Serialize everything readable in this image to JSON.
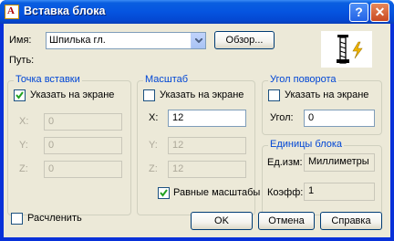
{
  "window": {
    "title": "Вставка блока"
  },
  "name_row": {
    "label": "Имя:",
    "value": "Шпилька гл.",
    "browse_label": "Обзор..."
  },
  "path_label": "Путь:",
  "insertion": {
    "title": "Точка вставки",
    "on_screen_label": "Указать на экране",
    "on_screen_checked": true,
    "x_label": "X:",
    "x_value": "0",
    "y_label": "Y:",
    "y_value": "0",
    "z_label": "Z:",
    "z_value": "0"
  },
  "scale": {
    "title": "Масштаб",
    "on_screen_label": "Указать на экране",
    "on_screen_checked": false,
    "x_label": "X:",
    "x_value": "12",
    "y_label": "Y:",
    "y_value": "12",
    "z_label": "Z:",
    "z_value": "12",
    "uniform_label": "Равные масштабы",
    "uniform_checked": true
  },
  "rotation": {
    "title": "Угол поворота",
    "on_screen_label": "Указать на экране",
    "on_screen_checked": false,
    "angle_label": "Угол:",
    "angle_value": "0"
  },
  "block_units": {
    "title": "Единицы блока",
    "units_label": "Ед.изм:",
    "units_value": "Миллиметры",
    "factor_label": "Коэфф:",
    "factor_value": "1"
  },
  "explode": {
    "label": "Расчленить",
    "checked": false
  },
  "buttons": {
    "ok": "OK",
    "cancel": "Отмена",
    "help": "Справка"
  },
  "colors": {
    "title_bar": "#0554e0",
    "group_title": "#0046d5",
    "face": "#ece9d8",
    "lightning": "#f0b400"
  }
}
